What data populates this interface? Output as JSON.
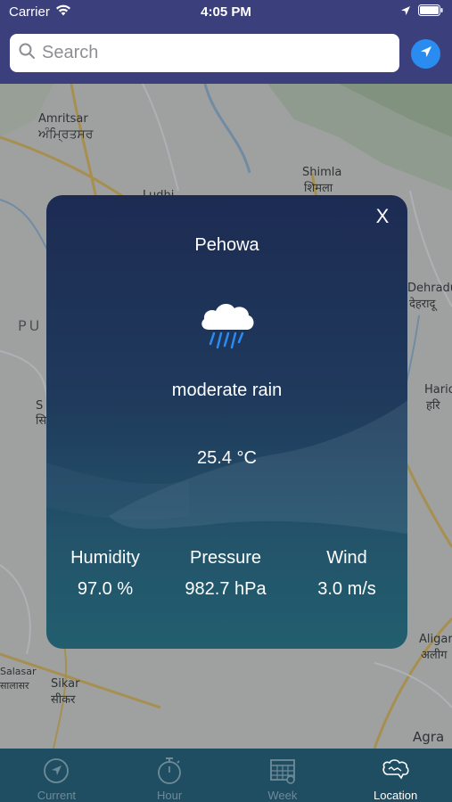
{
  "status_bar": {
    "carrier": "Carrier",
    "time": "4:05 PM"
  },
  "search": {
    "placeholder": "Search"
  },
  "map": {
    "labels": {
      "amritsar": "Amritsar",
      "amritsar_local": "ਅੰਮ੍ਰਿਤਸਰ",
      "shimla": "Shimla",
      "shimla_local": "शिमला",
      "ludhiana_partial": "Ludhi",
      "punjab_partial": "PU",
      "dehradun": "Dehradu",
      "dehradun_local": "देहरादू",
      "haridwar": "Hario",
      "haridwar_local": "हरि",
      "aligarh": "Aligar",
      "aligarh_local": "अलीग",
      "sikar": "Sikar",
      "sikar_local": "सीकर",
      "salasar": "Salasar",
      "salasar_local": "सालासर",
      "agra": "Agra",
      "s_partial": "S",
      "s_local_partial": "सि"
    }
  },
  "weather_card": {
    "close_label": "X",
    "city": "Pehowa",
    "icon": "rain-cloud-icon",
    "description": "moderate rain",
    "temperature": "25.4 °C",
    "humidity_label": "Humidity",
    "humidity_value": "97.0 %",
    "pressure_label": "Pressure",
    "pressure_value": "982.7 hPa",
    "wind_label": "Wind",
    "wind_value": "3.0 m/s"
  },
  "tabs": [
    {
      "label": "Current",
      "icon": "compass-icon",
      "active": false
    },
    {
      "label": "Hour",
      "icon": "stopwatch-icon",
      "active": false
    },
    {
      "label": "Week",
      "icon": "calendar-icon",
      "active": false
    },
    {
      "label": "Location",
      "icon": "map-cloud-icon",
      "active": true
    }
  ],
  "colors": {
    "header": "#3b3f7c",
    "tab_bar": "#1f4d62",
    "locate_button": "#2a8cf0",
    "rain_drops": "#2a8cf0"
  }
}
